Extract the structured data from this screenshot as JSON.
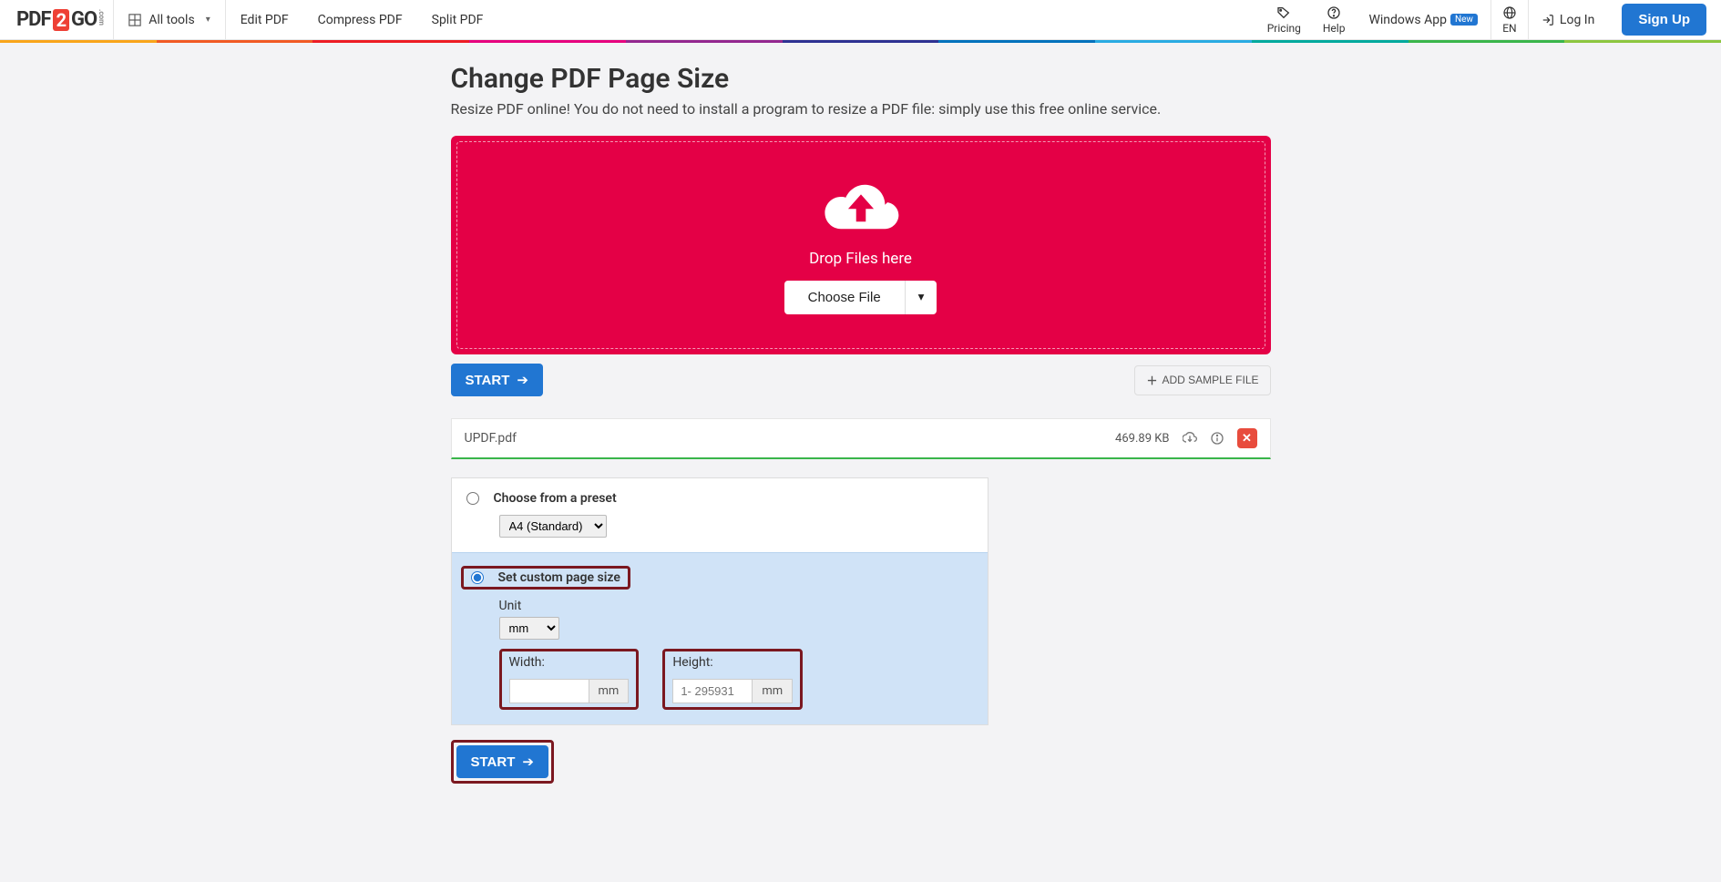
{
  "header": {
    "logo": {
      "p1": "PDF",
      "badge": "2",
      "go": "GO",
      "com": ".com"
    },
    "all_tools": "All tools",
    "links": {
      "edit": "Edit PDF",
      "compress": "Compress PDF",
      "split": "Split PDF"
    },
    "pricing": "Pricing",
    "help": "Help",
    "windows_app": "Windows App",
    "new_badge": "New",
    "lang": "EN",
    "login": "Log In",
    "signup": "Sign Up"
  },
  "page": {
    "title": "Change PDF Page Size",
    "subtitle": "Resize PDF online! You do not need to install a program to resize a PDF file: simply use this free online service."
  },
  "dropzone": {
    "drop_label": "Drop Files here",
    "choose": "Choose File"
  },
  "actions": {
    "start": "START",
    "sample": "ADD SAMPLE FILE"
  },
  "file": {
    "name": "UPDF.pdf",
    "size": "469.89 KB"
  },
  "options": {
    "preset_label": "Choose from a preset",
    "preset_value": "A4 (Standard)",
    "custom_label": "Set custom page size",
    "unit_label": "Unit",
    "unit_value": "mm",
    "width_label": "Width:",
    "width_suffix": "mm",
    "height_label": "Height:",
    "height_placeholder": "1- 295931",
    "height_suffix": "mm"
  }
}
